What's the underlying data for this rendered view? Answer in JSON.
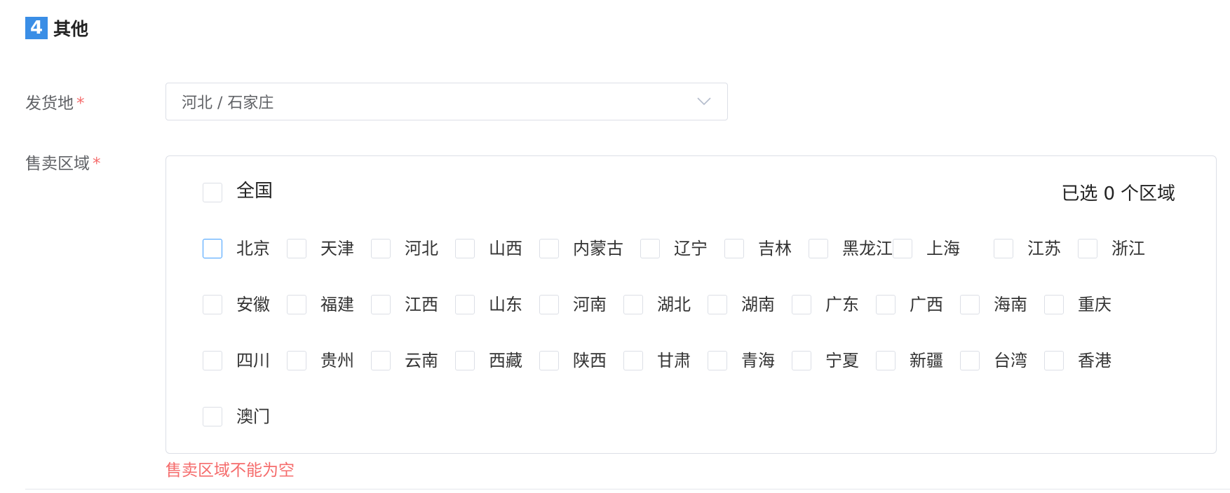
{
  "section": {
    "number": "4",
    "title": "其他"
  },
  "ship_from": {
    "label": "发货地",
    "required_mark": "*",
    "value": "河北 / 石家庄"
  },
  "sales_region": {
    "label": "售卖区域",
    "required_mark": "*",
    "all_label": "全国",
    "counter": {
      "prefix": "已选",
      "count": "0",
      "suffix": "个区域"
    },
    "regions": [
      "北京",
      "天津",
      "河北",
      "山西",
      "内蒙古",
      "辽宁",
      "吉林",
      "黑龙江",
      "上海",
      "江苏",
      "浙江",
      "安徽",
      "福建",
      "江西",
      "山东",
      "河南",
      "湖北",
      "湖南",
      "广东",
      "广西",
      "海南",
      "重庆",
      "四川",
      "贵州",
      "云南",
      "西藏",
      "陕西",
      "甘肃",
      "青海",
      "宁夏",
      "新疆",
      "台湾",
      "香港",
      "澳门"
    ],
    "error": "售卖区域不能为空"
  },
  "colors": {
    "accent": "#3a8ee6",
    "error": "#f56c6c",
    "border": "#dcdfe6",
    "focus": "#409eff"
  },
  "icons": {
    "select_arrow": "chevron-down-icon"
  }
}
